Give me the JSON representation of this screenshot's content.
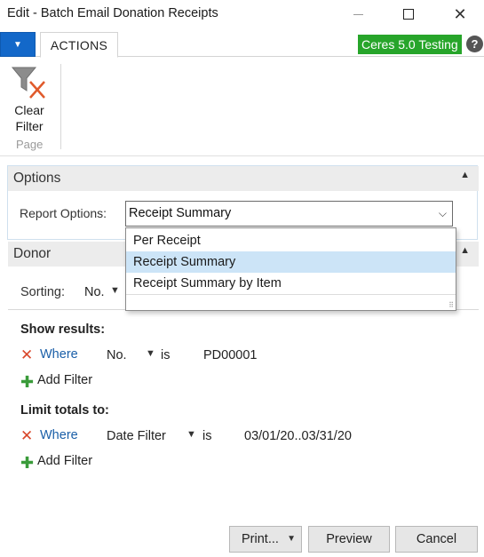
{
  "window": {
    "title": "Edit - Batch Email Donation Receipts",
    "minimize_icon": "minimize-icon",
    "maximize_icon": "maximize-icon",
    "close_symbol": "✕"
  },
  "ribbon": {
    "app_menu_symbol": "▼",
    "tab_actions": "ACTIONS",
    "company_badge": "Ceres 5.0 Testing",
    "company_badge_color": "#27a52a",
    "help_symbol": "?",
    "clear_filter_line1": "Clear",
    "clear_filter_line2": "Filter",
    "clear_filter_icon": "clear-filter-icon",
    "group_label": "Page"
  },
  "options": {
    "title": "Options",
    "collapse_symbol": "▲",
    "report_options_label": "Report Options:",
    "report_options_value": "Receipt Summary",
    "dropdown_arrow": "⌵",
    "dropdown_items": [
      "Per Receipt",
      "Receipt Summary",
      "Receipt Summary by Item"
    ],
    "selected_index": 1
  },
  "donor": {
    "title": "Donor",
    "collapse_symbol": "▲",
    "sorting_label": "Sorting:",
    "sorting_value": "No.",
    "sorting_arrow": "▼"
  },
  "show_results": {
    "heading": "Show results:",
    "remove_symbol": "✕",
    "where": "Where",
    "field": "No.",
    "field_arrow": "▼",
    "operator": "is",
    "value": "PD00001",
    "add_symbol": "✚",
    "add_filter": "Add Filter"
  },
  "limit_totals": {
    "heading": "Limit totals to:",
    "remove_symbol": "✕",
    "where": "Where",
    "field": "Date Filter",
    "field_arrow": "▼",
    "operator": "is",
    "value": "03/01/20..03/31/20",
    "add_symbol": "✚",
    "add_filter": "Add Filter"
  },
  "buttons": {
    "print": "Print...",
    "print_arrow": "▼",
    "preview": "Preview",
    "cancel": "Cancel"
  }
}
